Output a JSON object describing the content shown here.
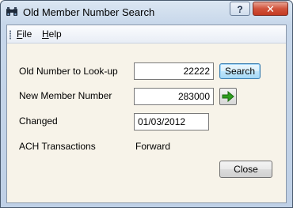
{
  "window": {
    "title": "Old Member Number Search",
    "help_button": "?",
    "close_button": "✕"
  },
  "menu": {
    "file": {
      "accel": "F",
      "rest": "ile"
    },
    "help": {
      "accel": "H",
      "rest": "elp"
    }
  },
  "form": {
    "old_number_label": "Old Number to Look-up",
    "old_number_value": "22222",
    "search_button": "Search",
    "new_member_label": "New Member Number",
    "new_member_value": "283000",
    "changed_label": "Changed",
    "changed_value": "01/03/2012",
    "ach_label": "ACH Transactions",
    "ach_value": "Forward"
  },
  "footer": {
    "close_button": "Close"
  },
  "icons": {
    "app_icon": "binoculars-icon",
    "go_icon": "green-arrow-right-icon"
  },
  "colors": {
    "titlebar": "#c7d7ea",
    "client_bg": "#f7f3e9",
    "close_red": "#c43a22",
    "arrow_green": "#2e9e1f"
  }
}
